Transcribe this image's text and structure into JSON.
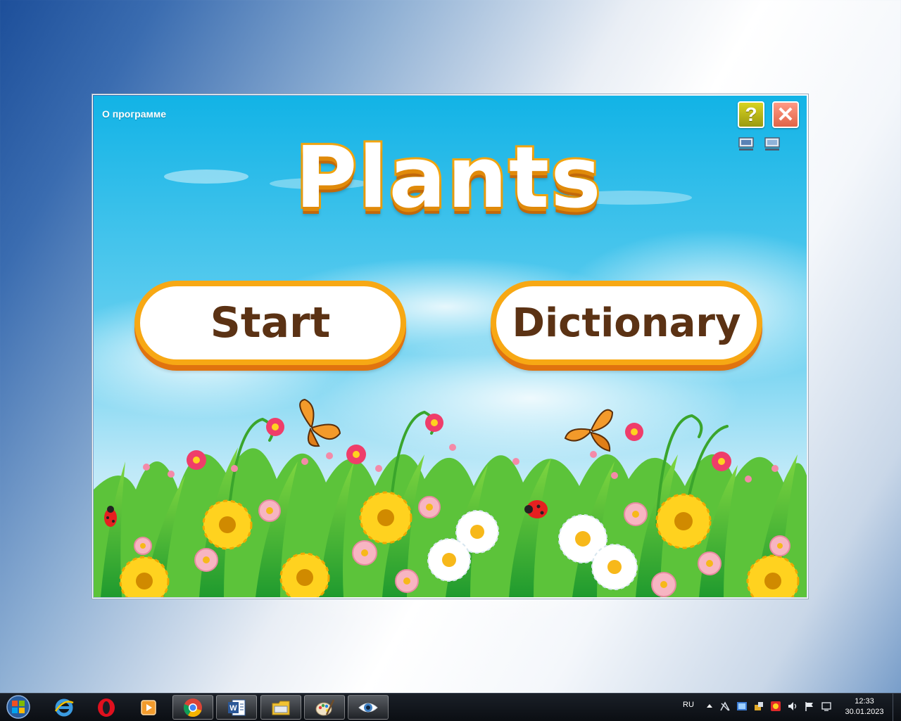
{
  "app": {
    "about_label": "О программе",
    "help_label": "?",
    "close_label": "✕",
    "title": "Plants",
    "start_label": "Start",
    "dictionary_label": "Dictionary"
  },
  "taskbar": {
    "apps": [
      {
        "icon": "internet-explorer-icon"
      },
      {
        "icon": "opera-icon"
      },
      {
        "icon": "media-player-icon"
      },
      {
        "icon": "chrome-icon"
      },
      {
        "icon": "word-icon"
      },
      {
        "icon": "file-explorer-icon"
      },
      {
        "icon": "paint-icon"
      },
      {
        "icon": "eye-app-icon"
      }
    ],
    "language": "RU",
    "time": "12:33",
    "date": "30.01.2023"
  },
  "colors": {
    "sky_top": "#1ab6e8",
    "orange_border": "#f7a814",
    "button_text": "#5b3214",
    "help_button": "#c9c21a",
    "close_button": "#f08066"
  }
}
